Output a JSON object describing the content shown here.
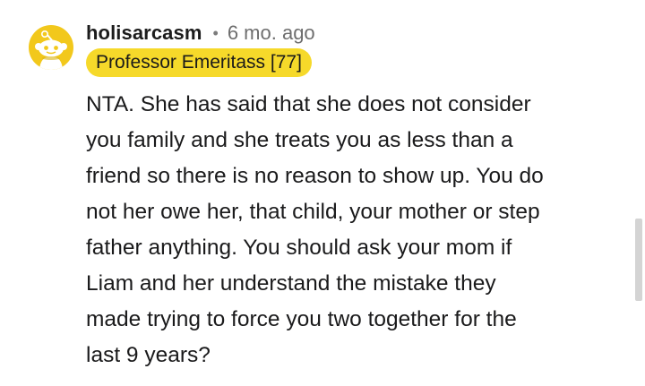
{
  "comment": {
    "username": "holisarcasm",
    "separator": "•",
    "timestamp": "6 mo. ago",
    "flair": "Professor Emeritass [77]",
    "avatar_icon": "snoo-avatar-icon",
    "body_lines": [
      "NTA. She has said that she does not consider",
      "you family and she treats you as less than a",
      "friend so there is no reason to show up. You do",
      "not her owe her, that child, your mother or step",
      "father anything. You should ask your mom if",
      "Liam and her understand the mistake they",
      "made trying to force you two together for the",
      "last 9 years?"
    ]
  },
  "colors": {
    "avatar_bg": "#f2c81c",
    "flair_bg": "#f6d92a",
    "text": "#1a1a1b",
    "meta": "#6e6e6e"
  }
}
